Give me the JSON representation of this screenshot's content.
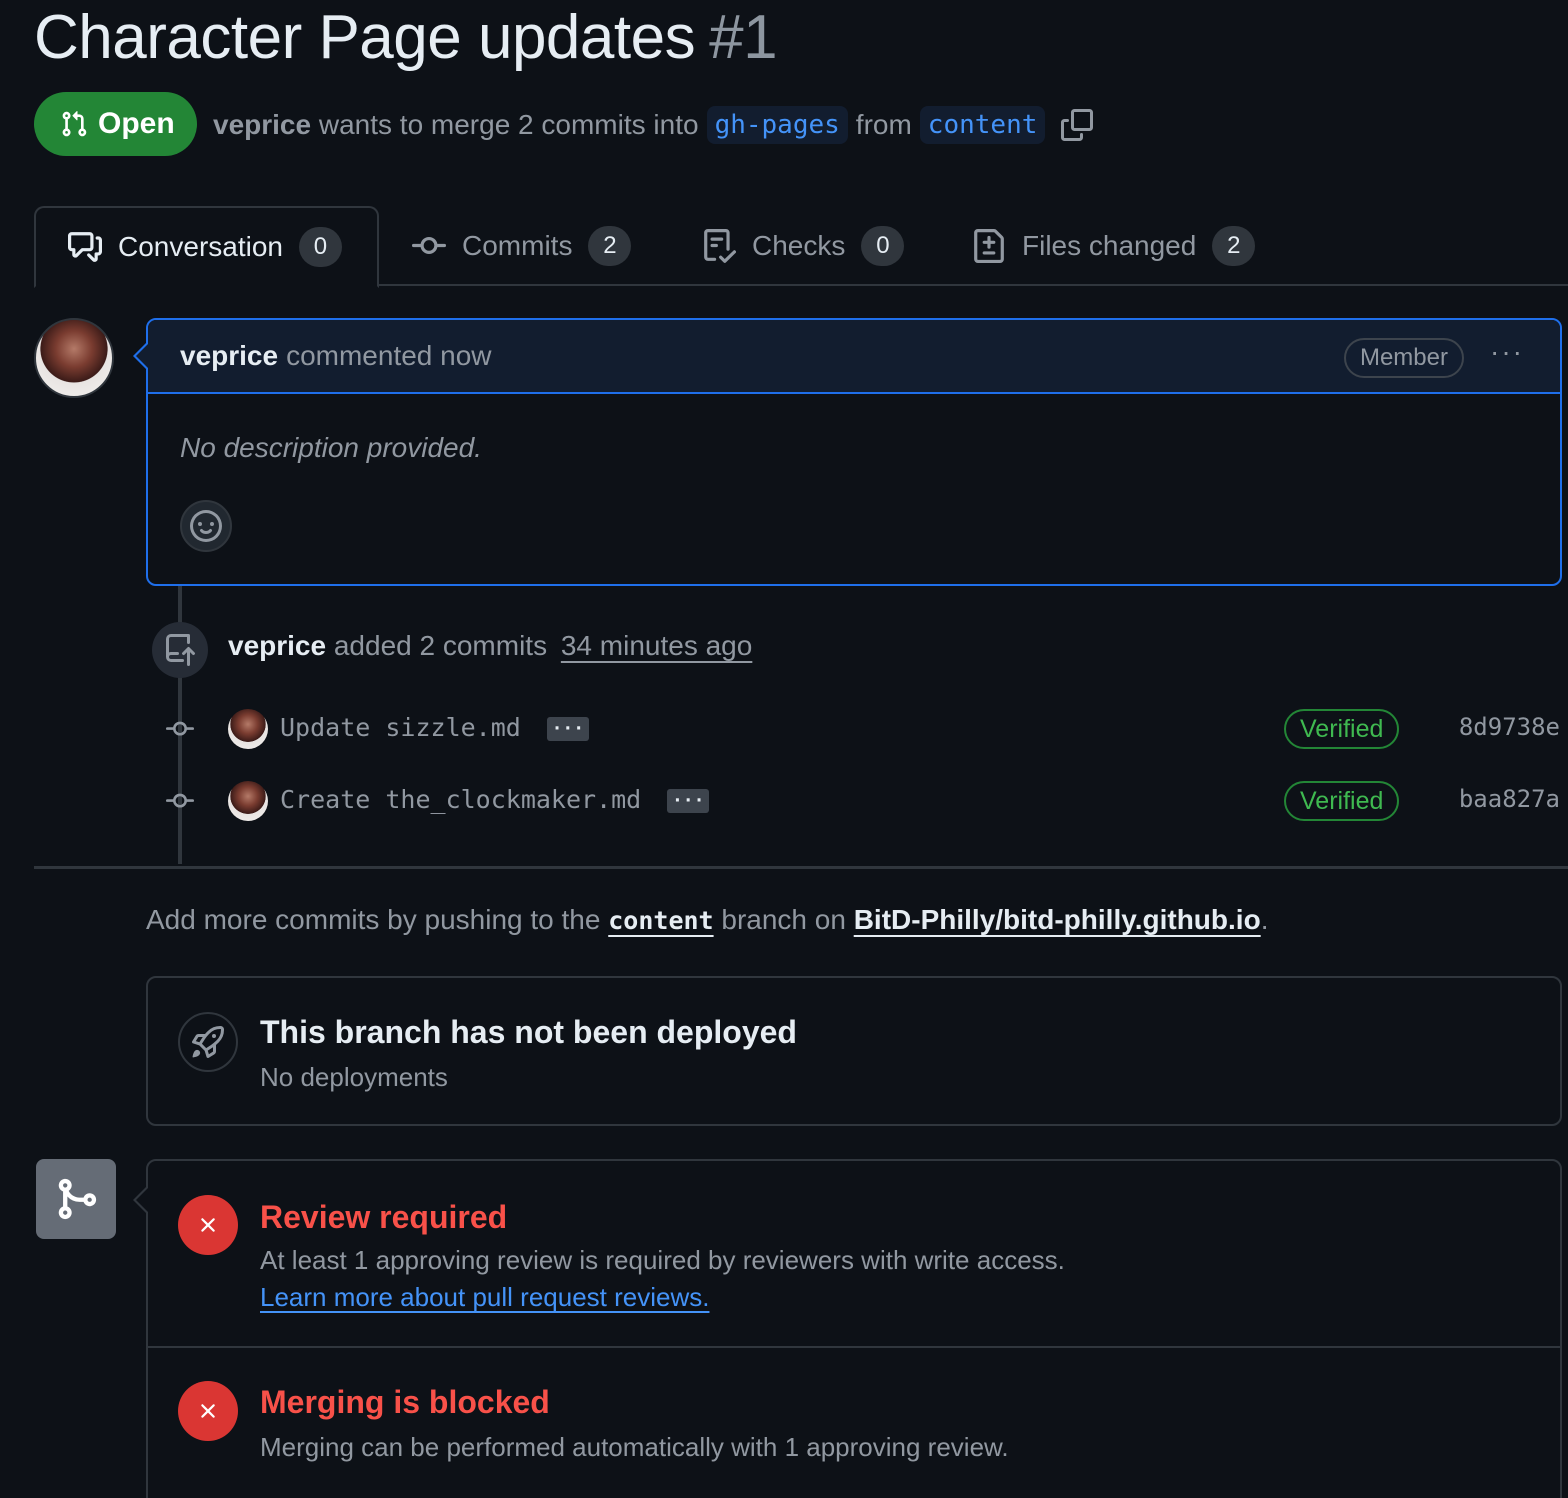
{
  "pr": {
    "title": "Character Page updates",
    "number": "#1",
    "state": "Open",
    "author": "veprice",
    "merge_text": "wants to merge 2 commits into",
    "base_branch": "gh-pages",
    "from_text": "from",
    "head_branch": "content"
  },
  "tabs": [
    {
      "label": "Conversation",
      "count": "0",
      "icon": "comment-discussion-icon"
    },
    {
      "label": "Commits",
      "count": "2",
      "icon": "git-commit-icon"
    },
    {
      "label": "Checks",
      "count": "0",
      "icon": "checklist-icon"
    },
    {
      "label": "Files changed",
      "count": "2",
      "icon": "file-diff-icon"
    }
  ],
  "comment": {
    "author": "veprice",
    "action": "commented now",
    "role_badge": "Member",
    "more": "···",
    "body": "No description provided."
  },
  "event": {
    "author": "veprice",
    "action": "added 2 commits",
    "time": "34 minutes ago"
  },
  "commits": [
    {
      "message": "Update sizzle.md",
      "status": "Verified",
      "sha": "8d9738e"
    },
    {
      "message": "Create the_clockmaker.md",
      "status": "Verified",
      "sha": "baa827a"
    }
  ],
  "commit_more": "···",
  "push_info": {
    "prefix": "Add more commits by pushing to the",
    "branch": "content",
    "middle": "branch on",
    "repo": "BitD-Philly/bitd-philly.github.io",
    "suffix": "."
  },
  "deploy": {
    "title": "This branch has not been deployed",
    "subtitle": "No deployments"
  },
  "merge_checks": [
    {
      "title": "Review required",
      "description": "At least 1 approving review is required by reviewers with write access.",
      "link": "Learn more about pull request reviews."
    },
    {
      "title": "Merging is blocked",
      "description": "Merging can be performed automatically with 1 approving review."
    }
  ],
  "colors": {
    "background": "#0d1117",
    "open_green": "#238636",
    "link_blue": "#4493f8",
    "error_red": "#f85149",
    "verified_green": "#3fb950"
  }
}
